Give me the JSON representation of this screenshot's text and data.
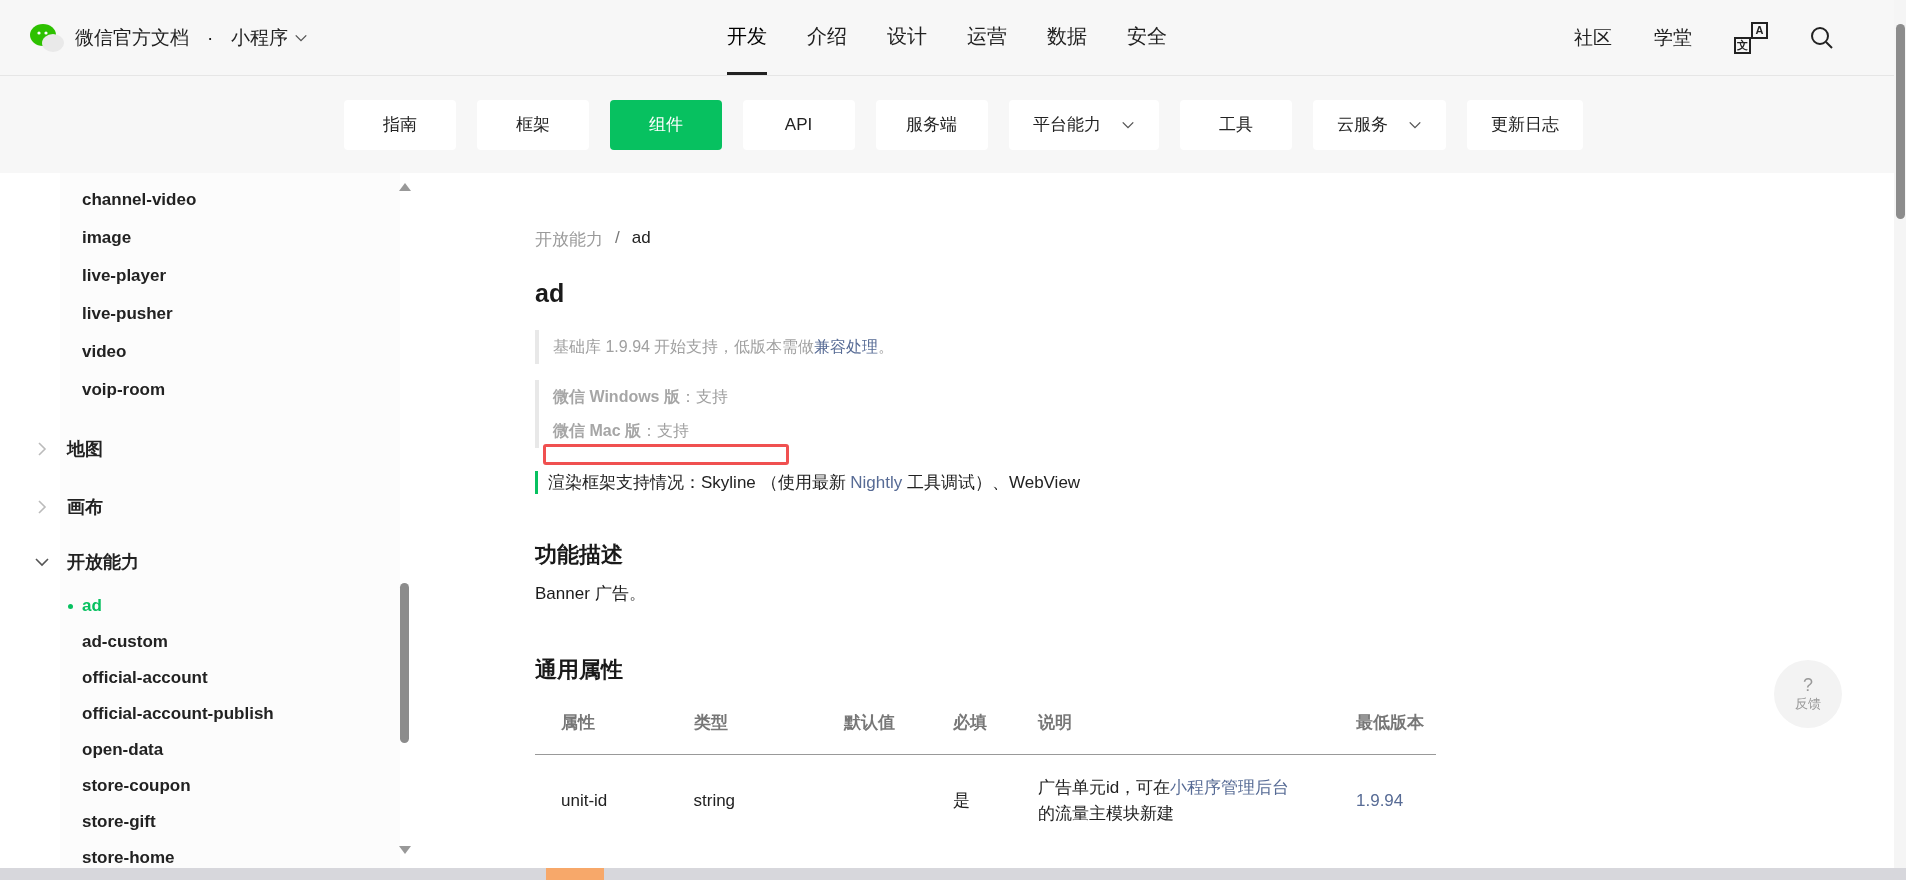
{
  "header": {
    "site_name": "微信官方文档",
    "separator": "·",
    "product": "小程序",
    "nav": [
      {
        "label": "开发",
        "selected": true
      },
      {
        "label": "介绍",
        "selected": false
      },
      {
        "label": "设计",
        "selected": false
      },
      {
        "label": "运营",
        "selected": false
      },
      {
        "label": "数据",
        "selected": false
      },
      {
        "label": "安全",
        "selected": false
      }
    ],
    "links": [
      "社区",
      "学堂"
    ],
    "translate_glyphs": [
      "文",
      "A"
    ]
  },
  "subnav": [
    {
      "label": "指南",
      "selected": false,
      "dropdown": false
    },
    {
      "label": "框架",
      "selected": false,
      "dropdown": false
    },
    {
      "label": "组件",
      "selected": true,
      "dropdown": false
    },
    {
      "label": "API",
      "selected": false,
      "dropdown": false
    },
    {
      "label": "服务端",
      "selected": false,
      "dropdown": false
    },
    {
      "label": "平台能力",
      "selected": false,
      "dropdown": true
    },
    {
      "label": "工具",
      "selected": false,
      "dropdown": false
    },
    {
      "label": "云服务",
      "selected": false,
      "dropdown": true
    },
    {
      "label": "更新日志",
      "selected": false,
      "dropdown": false
    }
  ],
  "sidebar": {
    "continued_children": [
      {
        "label": "channel-video",
        "selected": false
      },
      {
        "label": "image",
        "selected": false
      },
      {
        "label": "live-player",
        "selected": false
      },
      {
        "label": "live-pusher",
        "selected": false
      },
      {
        "label": "video",
        "selected": false
      },
      {
        "label": "voip-room",
        "selected": false
      }
    ],
    "groups": [
      {
        "label": "地图",
        "expanded": false
      },
      {
        "label": "画布",
        "expanded": false
      },
      {
        "label": "开放能力",
        "expanded": true,
        "children": [
          {
            "label": "ad",
            "selected": true
          },
          {
            "label": "ad-custom",
            "selected": false
          },
          {
            "label": "official-account",
            "selected": false
          },
          {
            "label": "official-account-publish",
            "selected": false
          },
          {
            "label": "open-data",
            "selected": false
          },
          {
            "label": "store-coupon",
            "selected": false
          },
          {
            "label": "store-gift",
            "selected": false
          },
          {
            "label": "store-home",
            "selected": false
          }
        ]
      }
    ]
  },
  "content": {
    "breadcrumb": {
      "parent": "开放能力",
      "separator": "/",
      "current": "ad"
    },
    "title": "ad",
    "version_note": {
      "before": "基础库 1.9.94 开始支持，低版本需做",
      "link": "兼容处理",
      "after": "。"
    },
    "platform_support": [
      "**微信 Windows 版**：支持",
      "**微信 Mac 版**：支持"
    ],
    "render_note": {
      "before": "渲染框架支持情况：Skyline （使用最新 ",
      "link": "Nightly",
      "after": " 工具调试）、WebView"
    },
    "description_heading": "功能描述",
    "description": "Banner 广告。",
    "properties_heading": "通用属性",
    "table": {
      "columns": [
        "属性",
        "类型",
        "默认值",
        "必填",
        "说明",
        "最低版本"
      ],
      "rows": [
        {
          "property": "unit-id",
          "type": "string",
          "required": "是",
          "description": {
            "before": "广告单元id，可在",
            "link": "小程序管理后台",
            "after": "的流量主模块新建"
          },
          "min_version": "1.9.94"
        }
      ]
    }
  },
  "feedback": {
    "icon": "?",
    "label": "反馈"
  }
}
